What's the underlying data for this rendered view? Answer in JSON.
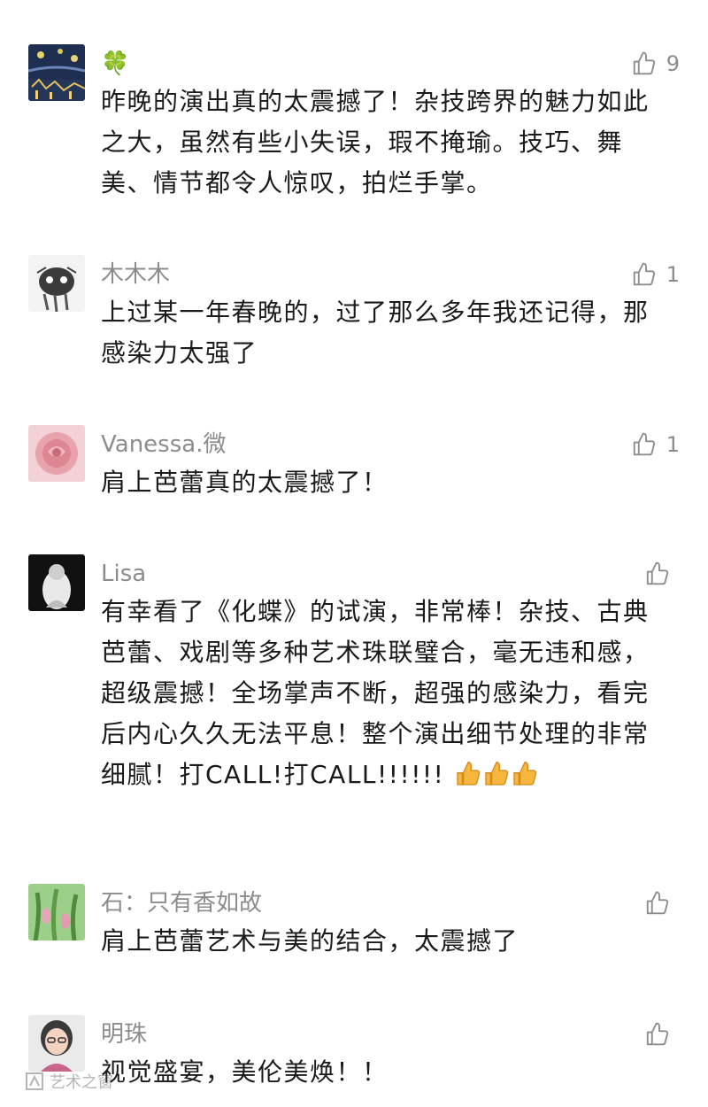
{
  "comments": [
    {
      "name": "🍀",
      "likes": "9",
      "text": "昨晚的演出真的太震撼了！杂技跨界的魅力如此之大，虽然有些小失误，瑕不掩瑜。技巧、舞美、情节都令人惊叹，拍烂手掌。"
    },
    {
      "name": "木木木",
      "likes": "1",
      "text": "上过某一年春晚的，过了那么多年我还记得，那感染力太强了"
    },
    {
      "name": "Vanessa.微",
      "likes": "1",
      "text": "肩上芭蕾真的太震撼了！"
    },
    {
      "name": "Lisa",
      "likes": "",
      "text": "有幸看了《化蝶》的试演，非常棒！杂技、古典芭蕾、戏剧等多种艺术珠联璧合，毫无违和感，超级震撼！全场掌声不断，超强的感染力，看完后内心久久无法平息！整个演出细节处理的非常细腻！打CALL!打CALL!!!!!!",
      "emoji": "thumbs-up-emoji x3"
    },
    {
      "name": "石：只有香如故",
      "likes": "",
      "text": "肩上芭蕾艺术与美的结合，太震撼了"
    },
    {
      "name": "明珠",
      "likes": "",
      "text": "视觉盛宴，美伦美焕！！"
    }
  ],
  "watermark": {
    "text": "艺术之窗"
  },
  "icons": {
    "like": "thumbs-up-outline-icon"
  },
  "colors": {
    "name": "#8c8c8c",
    "text": "#1a1a1a",
    "like": "#8c8c8c"
  }
}
